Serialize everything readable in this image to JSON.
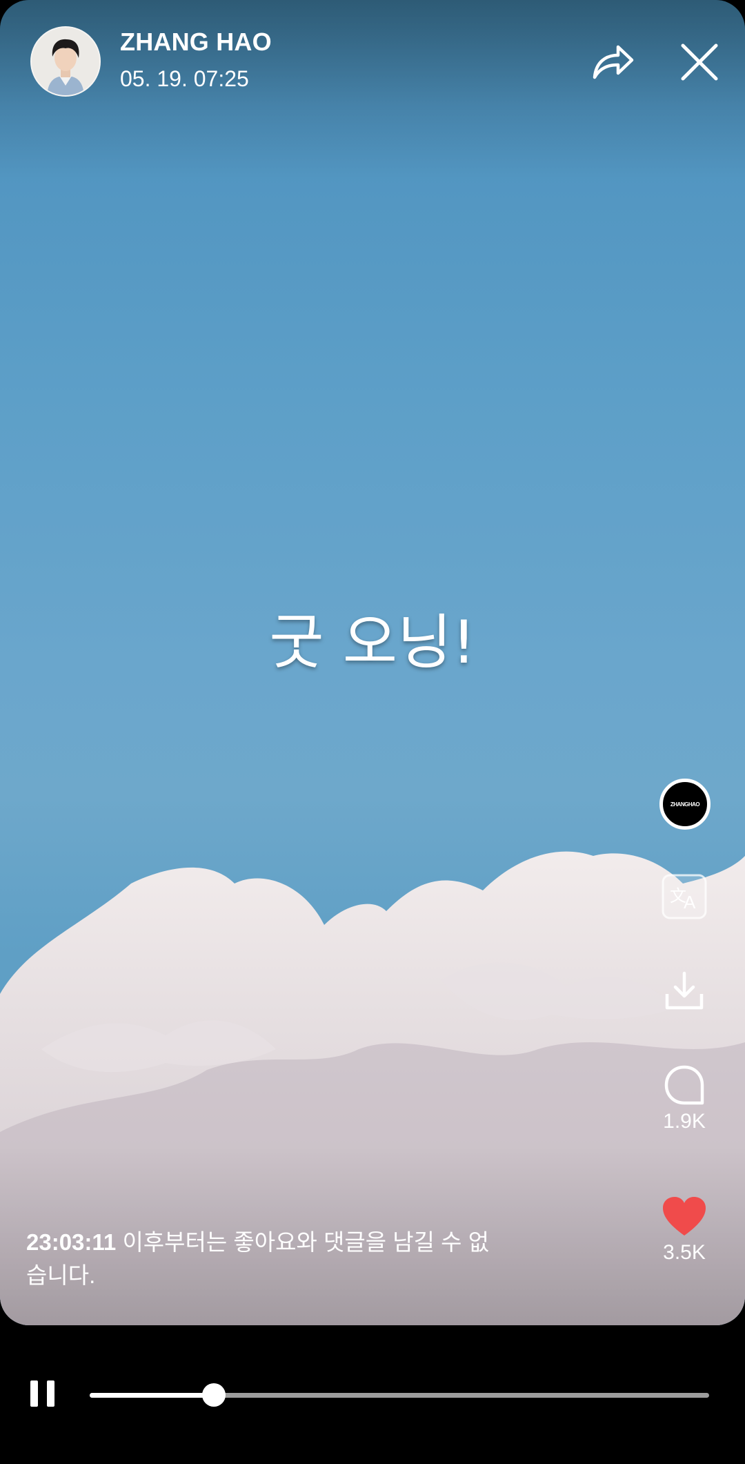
{
  "header": {
    "username": "ZHANG HAO",
    "timestamp": "05. 19. 07:25",
    "share_icon": "share-arrow-icon",
    "close_icon": "close-icon"
  },
  "post": {
    "caption": "굿 오닝!"
  },
  "rail": {
    "profile_label": "ZHANGHAO",
    "translate_icon": "translate-icon",
    "download_icon": "download-icon",
    "comment_icon": "comment-bubble-icon",
    "comment_count": "1.9K",
    "like_icon": "heart-icon",
    "like_count": "3.5K",
    "like_color": "#f04b4b"
  },
  "notice": {
    "time": "23:03:11",
    "text": " 이후부터는 좋아요와 댓글을 남길 수 없습니다."
  },
  "player": {
    "state_icon": "pause-icon",
    "progress_fraction": 0.2
  }
}
